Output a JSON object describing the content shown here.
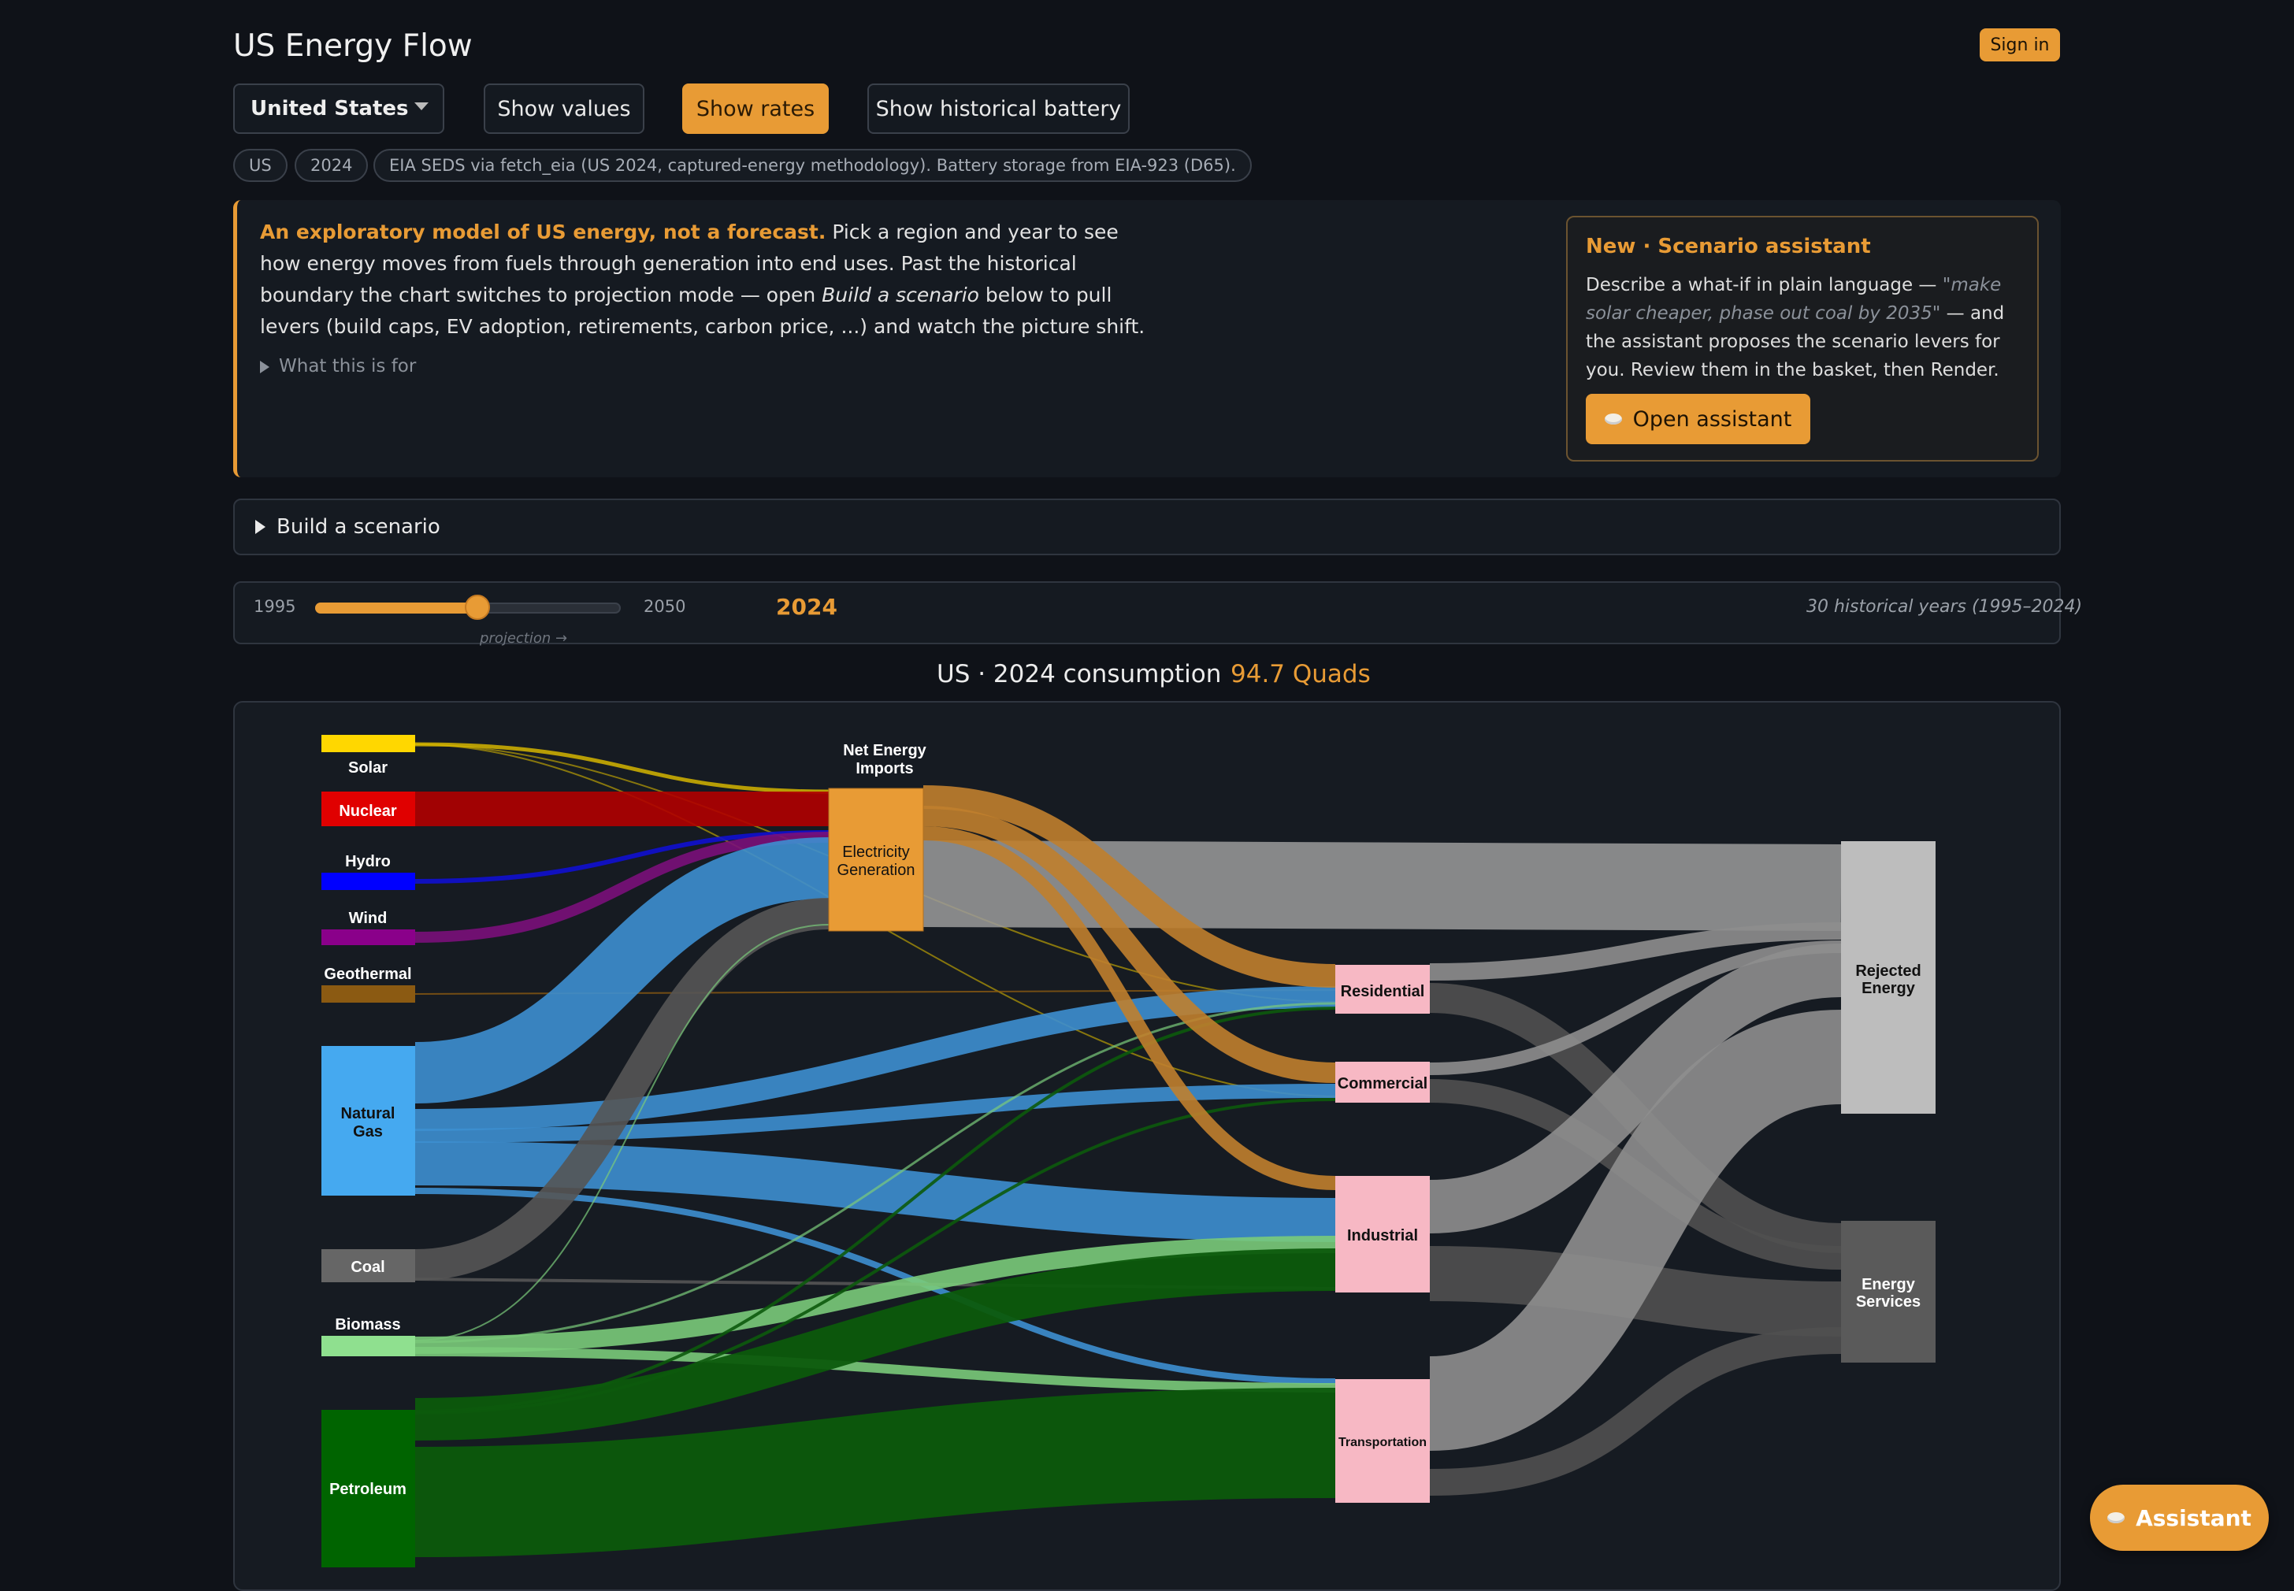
{
  "header": {
    "title": "US Energy Flow",
    "sign_in": "Sign in"
  },
  "controls": {
    "region": "United States",
    "show_values": "Show values",
    "show_rates": "Show rates",
    "show_battery": "Show historical battery"
  },
  "tags": {
    "region": "US",
    "year": "2024",
    "source": "EIA SEDS via fetch_eia (US 2024, captured-energy methodology). Battery storage from EIA-923 (D65)."
  },
  "intro": {
    "lead": "An exploratory model of US energy, not a forecast.",
    "body_1": " Pick a region and year to see how energy moves from fuels through generation into end uses. Past the historical boundary the chart switches to projection mode — open ",
    "body_em": "Build a scenario",
    "body_2": " below to pull levers (build caps, EV adoption, retirements, carbon price, ...) and watch the picture shift.",
    "what_for": "What this is for"
  },
  "assistant_card": {
    "title": "New · Scenario assistant",
    "desc_1": "Describe a what-if in plain language — ",
    "desc_em": "\"make solar cheaper, phase out coal by 2035\"",
    "desc_2": " — and the assistant proposes the scenario levers for you. Review them in the basket, then Render.",
    "button": "Open assistant"
  },
  "scenario": {
    "label": "Build a scenario"
  },
  "year_slider": {
    "min": "1995",
    "max": "2050",
    "current": "2024",
    "value": 2024,
    "projection": "projection →",
    "note": "30 historical years (1995–2024)"
  },
  "consumption": {
    "title": "US · 2024 consumption",
    "value": "94.7 Quads"
  },
  "chart_data": {
    "type": "sankey",
    "sources": [
      {
        "name": "Solar",
        "color": "#ffd700"
      },
      {
        "name": "Nuclear",
        "color": "#e00000"
      },
      {
        "name": "Hydro",
        "color": "#0000ff"
      },
      {
        "name": "Wind",
        "color": "#8a008a"
      },
      {
        "name": "Geothermal",
        "color": "#8b5a12"
      },
      {
        "name": "Natural Gas",
        "color": "#45a9f0"
      },
      {
        "name": "Coal",
        "color": "#666666"
      },
      {
        "name": "Biomass",
        "color": "#8fe08f"
      },
      {
        "name": "Petroleum",
        "color": "#006400"
      }
    ],
    "intermediate": [
      {
        "name": "Net Energy Imports"
      },
      {
        "name": "Electricity Generation",
        "color": "#e89b35"
      }
    ],
    "sectors": [
      {
        "name": "Residential",
        "color": "#f7b8c4"
      },
      {
        "name": "Commercial",
        "color": "#f7b8c4"
      },
      {
        "name": "Industrial",
        "color": "#f7b8c4"
      },
      {
        "name": "Transportation",
        "color": "#f7b8c4"
      }
    ],
    "sinks": [
      {
        "name": "Rejected Energy",
        "color": "#bdbdbd"
      },
      {
        "name": "Energy Services",
        "color": "#5a5a5a"
      }
    ]
  },
  "fab": {
    "label": "Assistant"
  }
}
